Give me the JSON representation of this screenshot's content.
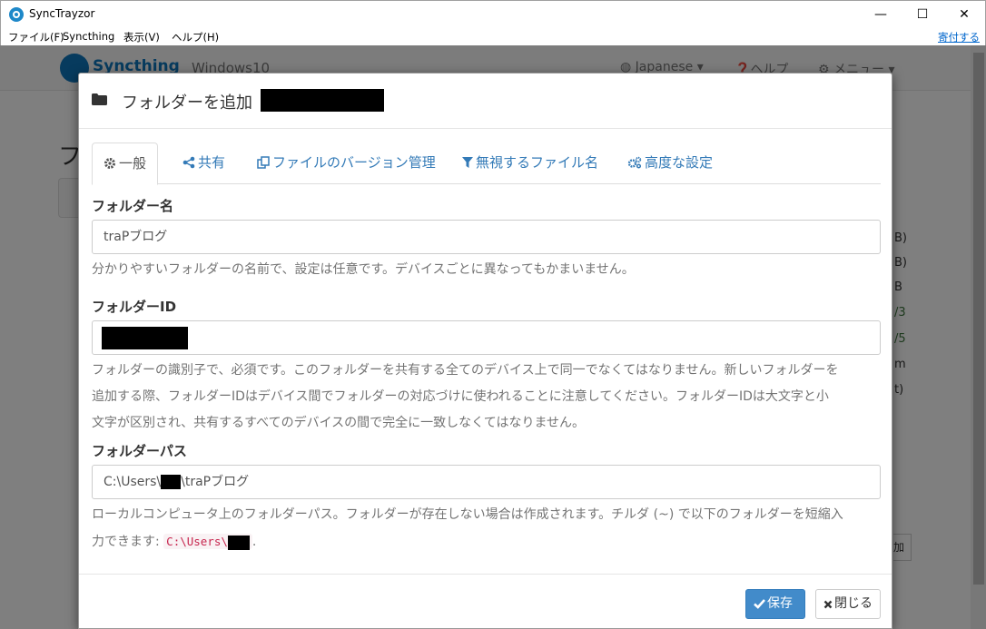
{
  "window": {
    "title": "SyncTrayzor",
    "minimize": "—",
    "maximize": "☐",
    "close": "✕"
  },
  "menubar": {
    "items": [
      "ファイル(F)",
      "Syncthing",
      "表示(V)",
      "ヘルプ(H)"
    ],
    "donate": "寄付する"
  },
  "background": {
    "logo": "Syncthing",
    "device": "Windows10",
    "language": "Japanese ▾",
    "help": "ヘルプ",
    "menu": "メニュー ▾",
    "heading": "フ",
    "side_values": [
      "B)",
      "B)",
      "B",
      "/3",
      "/5",
      "m",
      "t)"
    ],
    "button_fragment": "加"
  },
  "modal": {
    "title": "フォルダーを追加",
    "tabs": [
      {
        "label": "一般",
        "icon": "gear-icon",
        "active": true
      },
      {
        "label": "共有",
        "icon": "share-icon",
        "active": false
      },
      {
        "label": "ファイルのバージョン管理",
        "icon": "copy-icon",
        "active": false
      },
      {
        "label": "無視するファイル名",
        "icon": "filter-icon",
        "active": false
      },
      {
        "label": "高度な設定",
        "icon": "cogs-icon",
        "active": false
      }
    ],
    "fields": {
      "folder_name": {
        "label": "フォルダー名",
        "value": "traPブログ",
        "help": "分かりやすいフォルダーの名前で、設定は任意です。デバイスごとに異なってもかまいません。"
      },
      "folder_id": {
        "label": "フォルダーID",
        "value": "",
        "help_lines": [
          "フォルダーの識別子で、必須です。このフォルダーを共有する全てのデバイス上で同一でなくてはなりません。新しいフォルダーを",
          "追加する際、フォルダーIDはデバイス間でフォルダーの対応づけに使われることに注意してください。フォルダーIDは大文字と小",
          "文字が区別され、共有するすべてのデバイスの間で完全に一致しなくてはなりません。"
        ]
      },
      "folder_path": {
        "label": "フォルダーパス",
        "value_prefix": "C:\\Users\\",
        "value_suffix": "\\traPブログ",
        "help_line1": "ローカルコンピュータ上のフォルダーパス。フォルダーが存在しない場合は作成されます。チルダ (~) で以下のフォルダーを短縮入",
        "help_line2_prefix": "力できます: ",
        "help_code": "C:\\Users\\",
        "help_line2_suffix": "."
      }
    },
    "footer": {
      "save": "保存",
      "close": "閉じる"
    }
  },
  "colors": {
    "accent": "#337ab7",
    "primary_button": "#428bca",
    "code_text": "#c7254e"
  }
}
